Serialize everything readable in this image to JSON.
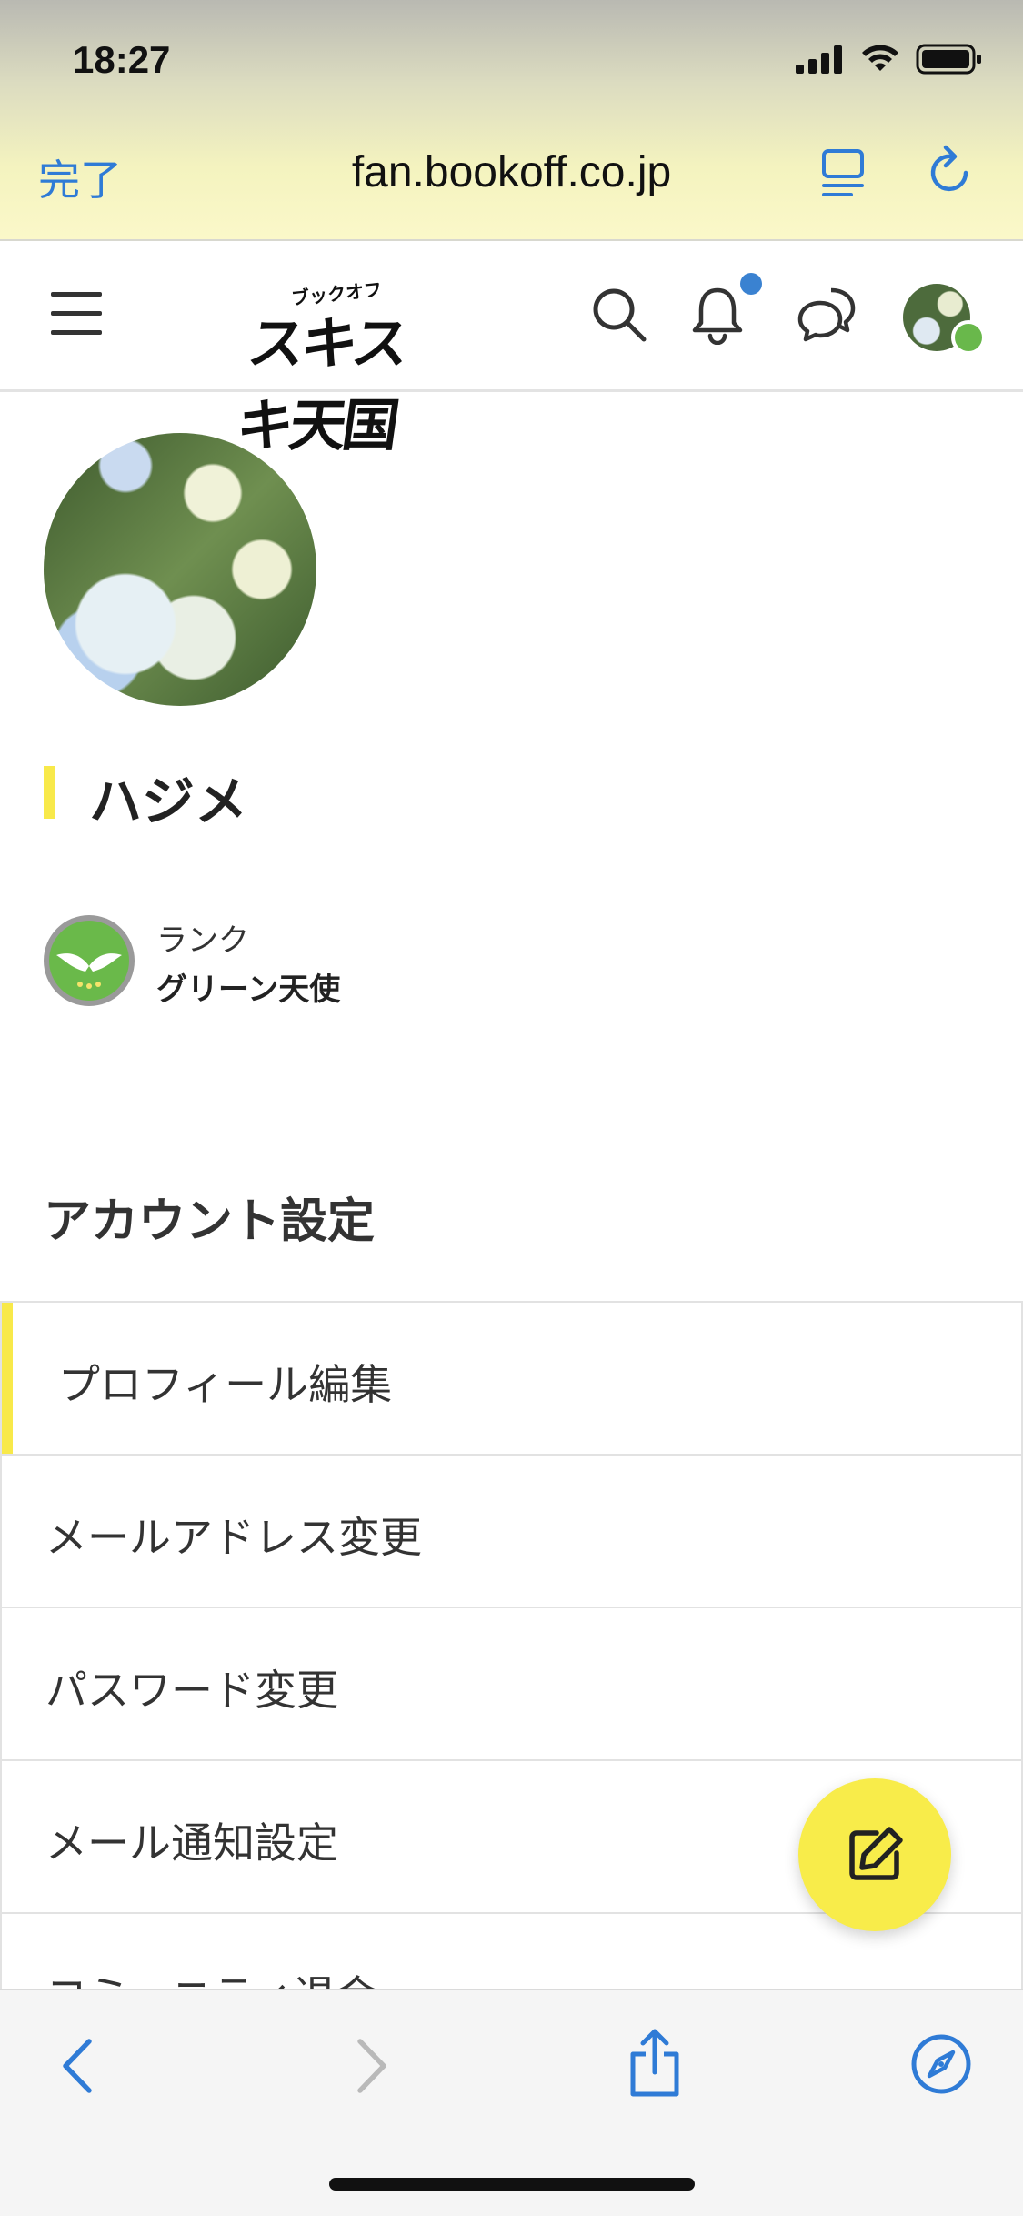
{
  "status_bar": {
    "time": "18:27"
  },
  "browser": {
    "done_label": "完了",
    "url": "fan.bookoff.co.jp"
  },
  "site_header": {
    "logo_top": "ブックオフ",
    "logo_main": "スキスキ天国",
    "has_unread_notification": true,
    "accent_color": "#3a82d1"
  },
  "profile": {
    "name": "ハジメ",
    "rank_label": "ランク",
    "rank_value": "グリーン天使",
    "rank_badge_text": "グリーン天使"
  },
  "account_settings": {
    "title": "アカウント設定",
    "items": [
      {
        "label": "プロフィール編集",
        "active": true
      },
      {
        "label": "メールアドレス変更",
        "active": false
      },
      {
        "label": "パスワード変更",
        "active": false
      },
      {
        "label": "メール通知設定",
        "active": false
      },
      {
        "label": "コミュニティ退会",
        "active": false
      }
    ]
  },
  "fab": {
    "icon": "edit-icon",
    "color": "#f8ec4a"
  },
  "theme": {
    "highlight": "#f8e94a",
    "link": "#2f7bd6"
  }
}
